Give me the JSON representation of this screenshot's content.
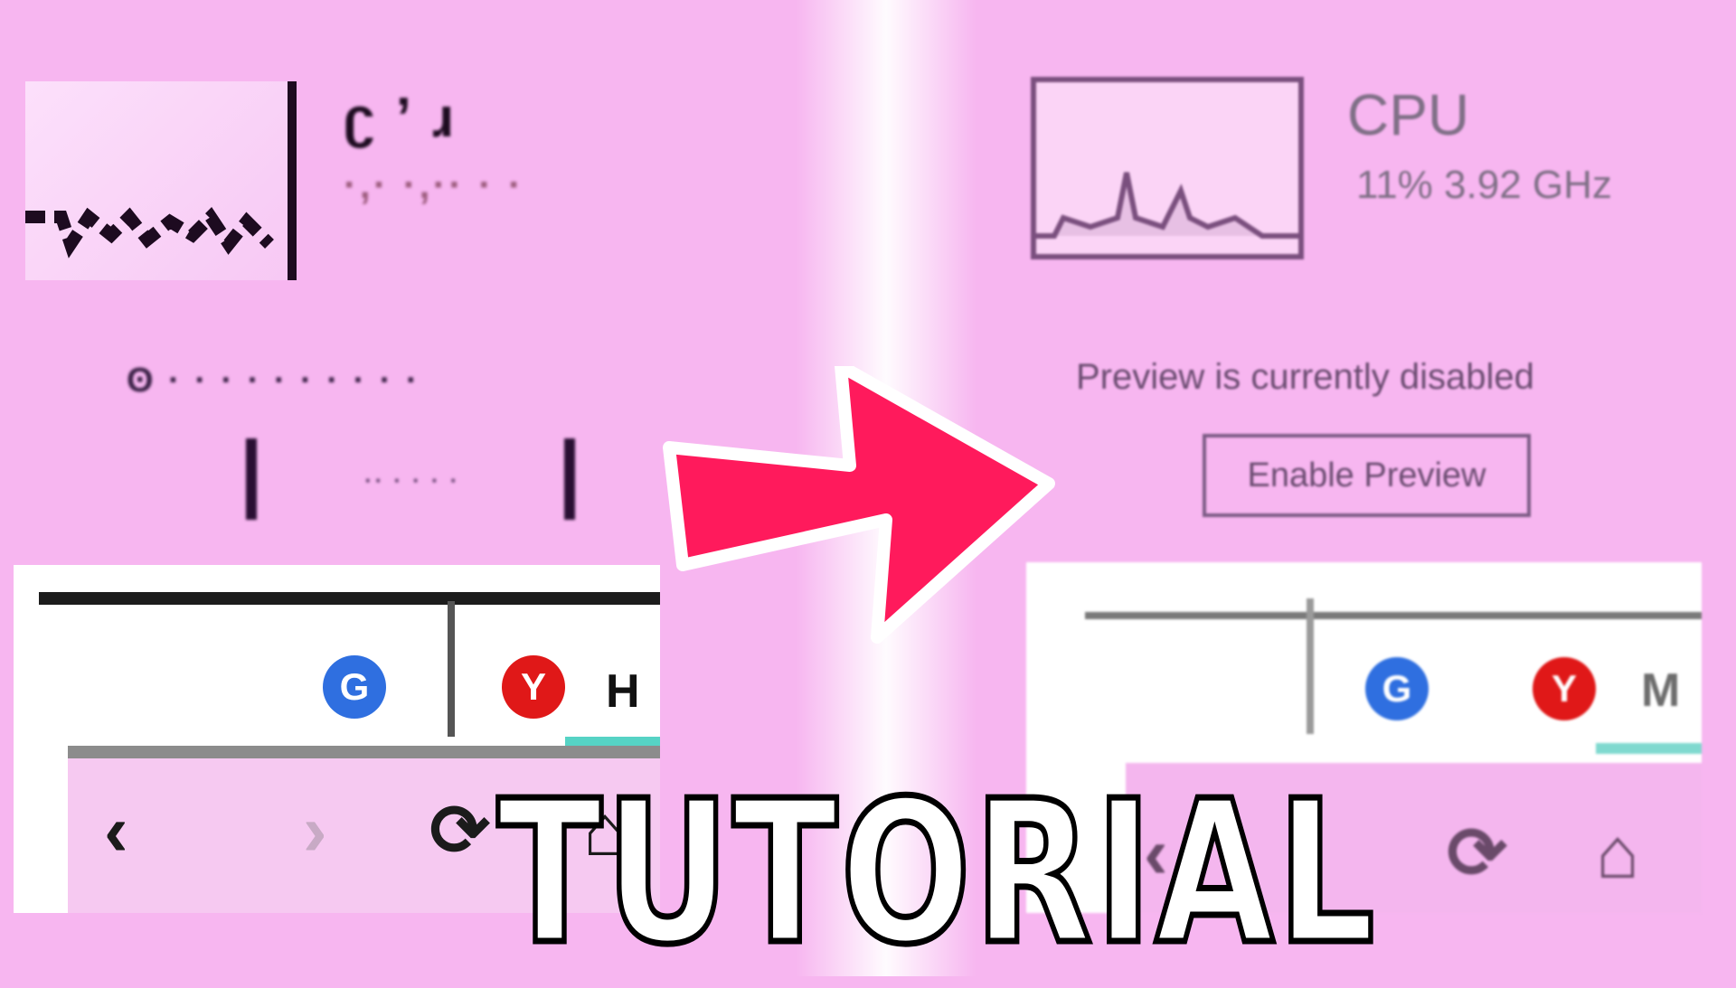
{
  "left": {
    "cpu_garbled": "ʗ ʼ ɹ",
    "stats_garbled": "·,· ·,·· · ·",
    "preview_garbled": "ʘ · · · · · · · · · ·",
    "button_garbled": "·· · · · ·"
  },
  "right": {
    "cpu_title": "CPU",
    "cpu_stats": "11% 3.92 GHz",
    "preview_message": "Preview is currently disabled",
    "enable_button": "Enable Preview"
  },
  "browser": {
    "favicon_g": "G",
    "favicon_y": "Y",
    "tab_label_left": "H",
    "tab_label_right": "M",
    "back_icon": "‹",
    "forward_icon": "›",
    "reload_icon": "⟳",
    "home_icon": "⌂"
  },
  "title": "TUTORIAL",
  "colors": {
    "background": "#f7b6f0",
    "arrow": "#ff1a5c",
    "arrow_border": "#ffffff",
    "title_fill": "#ffffff",
    "title_stroke": "#000000"
  }
}
